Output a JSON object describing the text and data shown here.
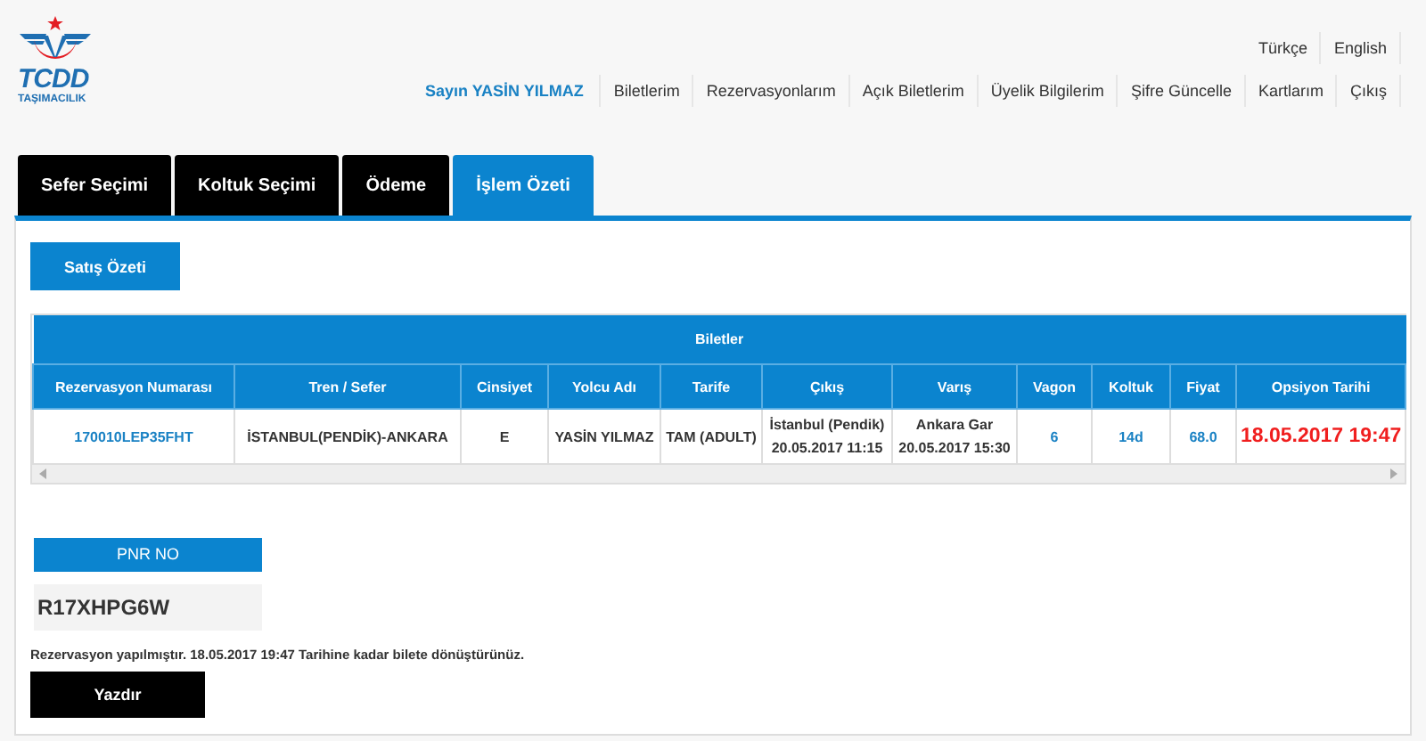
{
  "logo": {
    "title": "TCDD",
    "subtitle": "TAŞIMACILIK"
  },
  "languages": [
    {
      "label": "Türkçe"
    },
    {
      "label": "English"
    }
  ],
  "user_greeting": "Sayın YASİN YILMAZ",
  "nav": [
    {
      "label": "Biletlerim"
    },
    {
      "label": "Rezervasyonlarım"
    },
    {
      "label": "Açık Biletlerim"
    },
    {
      "label": "Üyelik Bilgilerim"
    },
    {
      "label": "Şifre Güncelle"
    },
    {
      "label": "Kartlarım"
    },
    {
      "label": "Çıkış"
    }
  ],
  "tabs": [
    {
      "label": "Sefer Seçimi",
      "selected": false
    },
    {
      "label": "Koltuk Seçimi",
      "selected": false
    },
    {
      "label": "Ödeme",
      "selected": false
    },
    {
      "label": "İşlem Özeti",
      "selected": true
    }
  ],
  "summary_button": "Satış Özeti",
  "table": {
    "title": "Biletler",
    "columns": [
      "Rezervasyon Numarası",
      "Tren / Sefer",
      "Cinsiyet",
      "Yolcu Adı",
      "Tarife",
      "Çıkış",
      "Varış",
      "Vagon",
      "Koltuk",
      "Fiyat",
      "Opsiyon Tarihi"
    ],
    "rows": [
      {
        "cells": [
          {
            "kind": "link",
            "lines": [
              "170010LEP35FHT"
            ]
          },
          {
            "kind": "text",
            "lines": [
              "İSTANBUL(PENDİK)-ANKARA"
            ]
          },
          {
            "kind": "text",
            "lines": [
              "E"
            ]
          },
          {
            "kind": "text",
            "lines": [
              "YASİN YILMAZ"
            ]
          },
          {
            "kind": "text",
            "lines": [
              "TAM (ADULT)"
            ]
          },
          {
            "kind": "text",
            "lines": [
              "İstanbul (Pendik)",
              "20.05.2017 11:15"
            ]
          },
          {
            "kind": "text",
            "lines": [
              "Ankara Gar",
              "20.05.2017 15:30"
            ]
          },
          {
            "kind": "link",
            "lines": [
              "6"
            ]
          },
          {
            "kind": "link",
            "lines": [
              "14d"
            ]
          },
          {
            "kind": "link",
            "lines": [
              "68.0"
            ]
          },
          {
            "kind": "alert",
            "lines": [
              "18.05.2017 19:47"
            ]
          }
        ]
      }
    ]
  },
  "pnr": {
    "label": "PNR NO",
    "value": "R17XHPG6W"
  },
  "message": "Rezervasyon yapılmıştır. 18.05.2017 19:47 Tarihine kadar bilete dönüştürünüz.",
  "print_button": "Yazdır"
}
